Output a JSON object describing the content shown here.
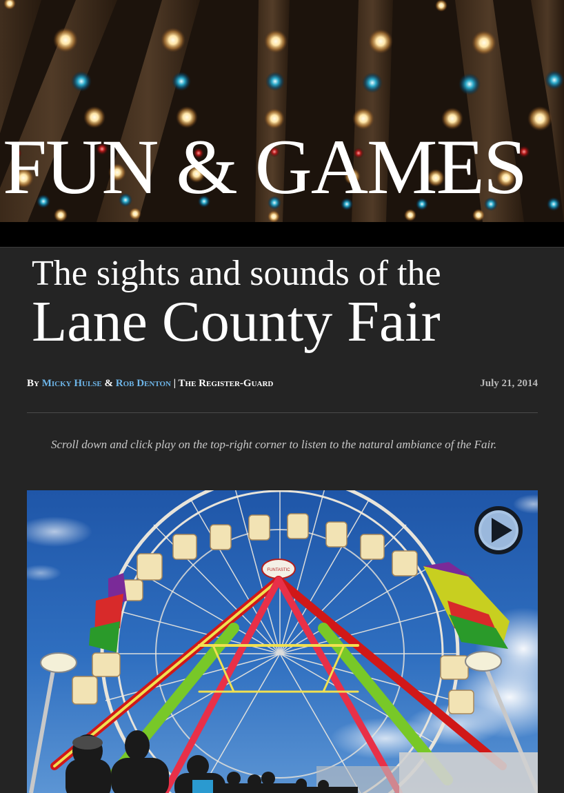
{
  "hero": {
    "title": "FUN & GAMES"
  },
  "headline": {
    "line1": "The sights and sounds of the",
    "line2": "Lane County Fair"
  },
  "byline": {
    "prefix": "By",
    "author1": "Micky Hulse",
    "conjunction": "&",
    "author2": "Rob Denton",
    "separator": "|",
    "publication": "The Register-Guard",
    "date": "July 21, 2014"
  },
  "intro": {
    "text": "Scroll down and click play on the top-right corner to listen to the natural ambiance of the Fair."
  },
  "photo": {
    "sign_text": "FUNTASTIC",
    "play_icon": "play-icon"
  },
  "colors": {
    "background": "#242424",
    "link": "#6db5e8",
    "date": "#b9b9b9",
    "intro": "#c8c8c8"
  }
}
